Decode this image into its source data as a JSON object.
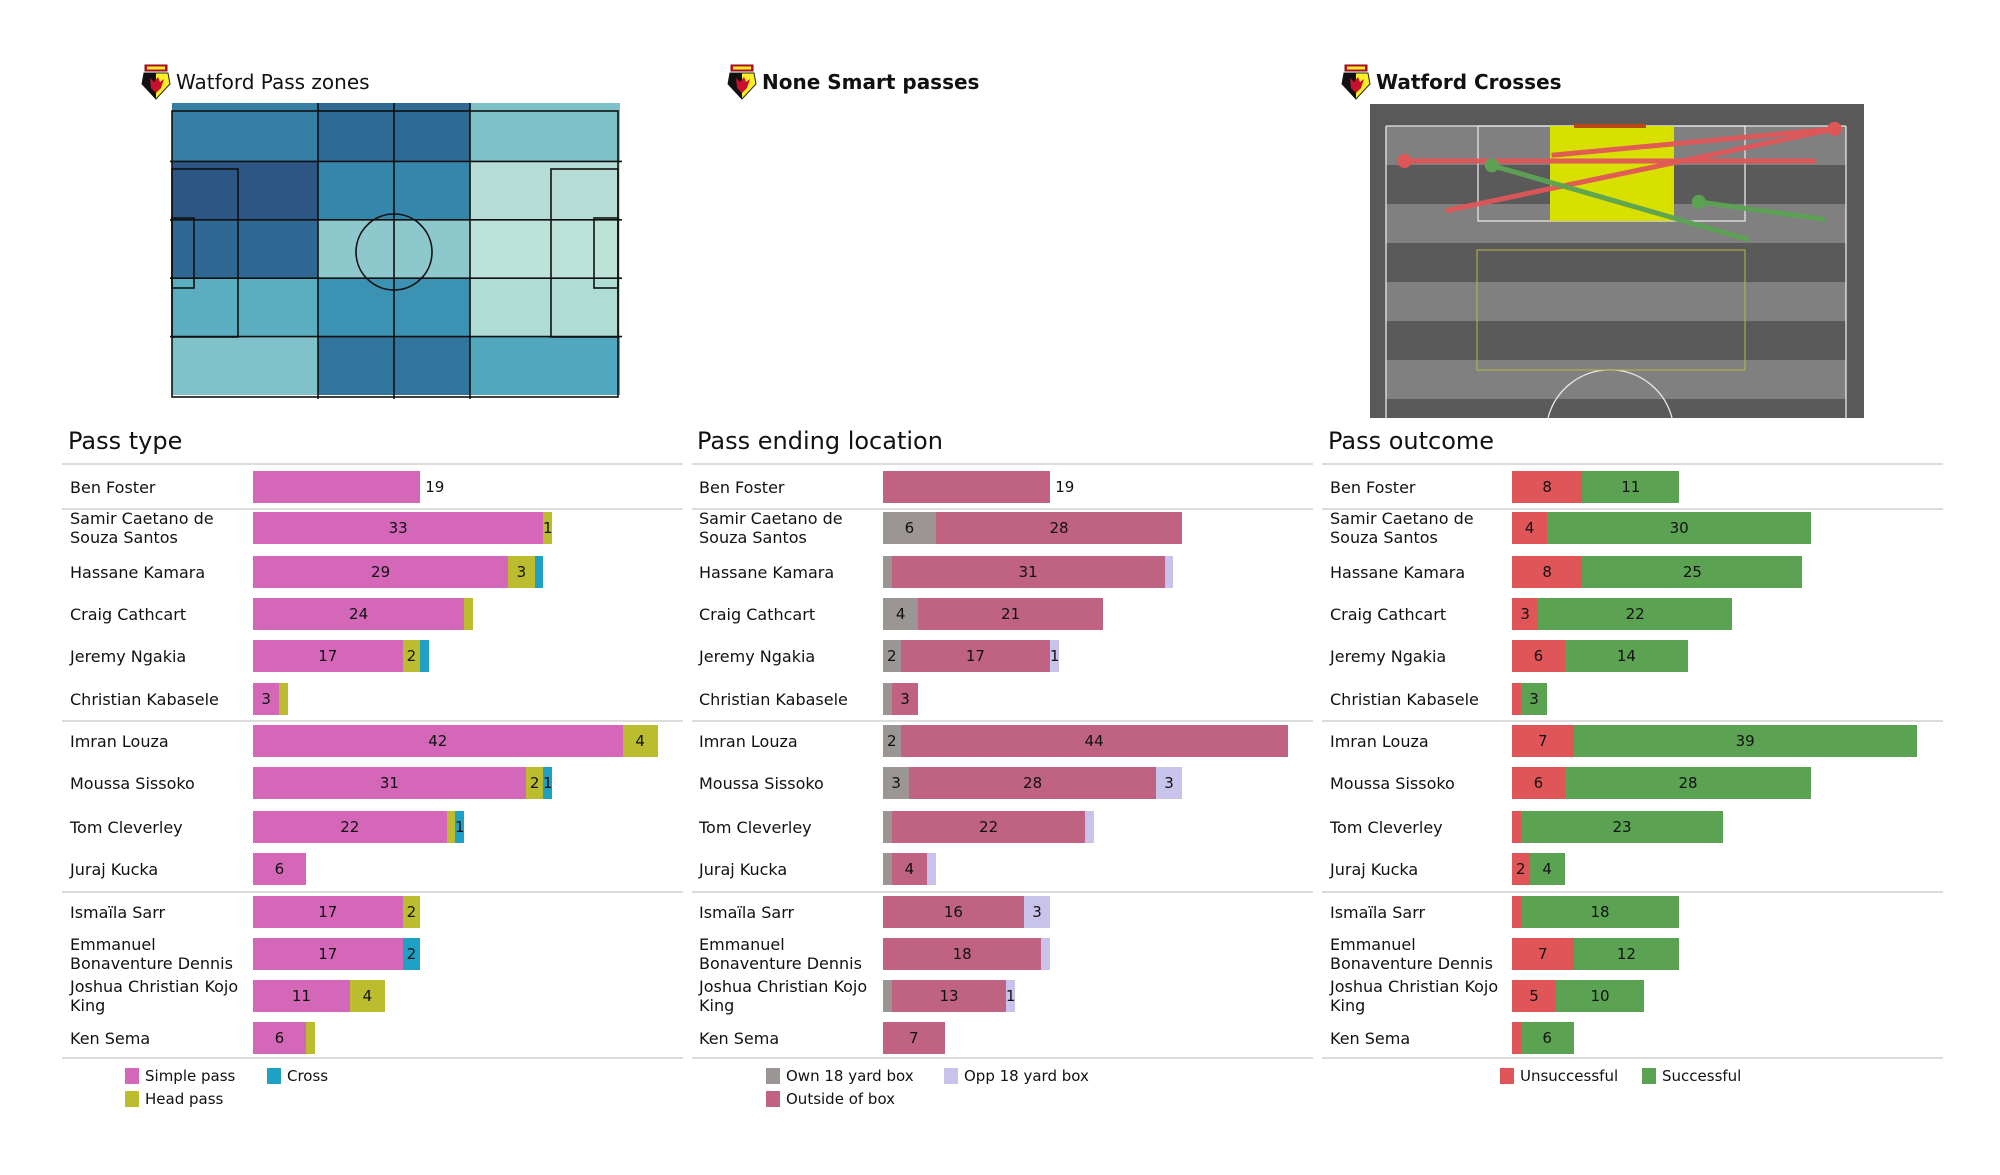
{
  "colors": {
    "simple_pass": "#d467b8",
    "head_pass": "#bcbd2e",
    "cross": "#1fa1c6",
    "own_box": "#9b9594",
    "outside_box": "#c06282",
    "opp_box": "#c8c3ea",
    "unsuccessful": "#e05658",
    "successful": "#5ba353"
  },
  "panels": {
    "pass_zones": {
      "title": "Watford Pass zones",
      "logo_icon": "watford-crest-icon"
    },
    "smart_passes": {
      "title": "None Smart passes",
      "logo_icon": "watford-crest-icon"
    },
    "crosses": {
      "title": "Watford Crosses",
      "logo_icon": "watford-crest-icon"
    }
  },
  "pass_zones": {
    "grid_cols": 3,
    "grid_rows": 5,
    "zone_colors": [
      [
        "#347fa3",
        "#2f6a94",
        "#7fc1c9"
      ],
      [
        "#2c5785",
        "#3586ab",
        "#b5ddd5"
      ],
      [
        "#306894",
        "#8cc8cc",
        "#bde3d8"
      ],
      [
        "#5aaec0",
        "#3b92b2",
        "#b0dcd6"
      ],
      [
        "#80c1ca",
        "#31749c",
        "#51a7bd"
      ]
    ]
  },
  "crosses": {
    "items": [
      {
        "outcome": "unsuccessful",
        "start": [
          0.975,
          0.01
        ],
        "end": [
          0.13,
          0.29
        ]
      },
      {
        "outcome": "unsuccessful",
        "start": [
          0.975,
          0.01
        ],
        "end": [
          0.36,
          0.1
        ]
      },
      {
        "outcome": "unsuccessful",
        "start": [
          0.04,
          0.12
        ],
        "end": [
          0.935,
          0.12
        ]
      },
      {
        "outcome": "successful",
        "start": [
          0.23,
          0.135
        ],
        "end": [
          0.79,
          0.39
        ]
      },
      {
        "outcome": "successful",
        "start": [
          0.68,
          0.26
        ],
        "end": [
          0.955,
          0.32
        ]
      }
    ]
  },
  "chart_data": [
    {
      "type": "bar",
      "orientation": "horizontal-stacked",
      "title": "Pass type",
      "categories": [
        "Ben Foster",
        "Samir Caetano de Souza Santos",
        "Hassane Kamara",
        "Craig Cathcart",
        "Jeremy Ngakia",
        "Christian Kabasele",
        "Imran Louza",
        "Moussa Sissoko",
        "Tom Cleverley",
        "Juraj Kucka",
        "Ismaïla Sarr",
        "Emmanuel Bonaventure Dennis",
        "Joshua Christian Kojo King",
        "Ken Sema"
      ],
      "category_lines": [
        [
          "Ben Foster"
        ],
        [
          "Samir Caetano de",
          "Souza Santos"
        ],
        [
          "Hassane Kamara"
        ],
        [
          "Craig Cathcart"
        ],
        [
          "Jeremy Ngakia"
        ],
        [
          "Christian Kabasele"
        ],
        [
          "Imran Louza"
        ],
        [
          "Moussa Sissoko"
        ],
        [
          "Tom Cleverley"
        ],
        [
          "Juraj Kucka"
        ],
        [
          "Ismaïla Sarr"
        ],
        [
          "Emmanuel",
          "Bonaventure Dennis"
        ],
        [
          "Joshua Christian Kojo",
          "King"
        ],
        [
          "Ken Sema"
        ]
      ],
      "group_breaks_after": [
        0,
        5,
        9
      ],
      "series": [
        {
          "name": "Simple pass",
          "color_key": "simple_pass",
          "values": [
            19,
            33,
            29,
            24,
            17,
            3,
            42,
            31,
            22,
            6,
            17,
            17,
            11,
            6
          ]
        },
        {
          "name": "Head pass",
          "color_key": "head_pass",
          "values": [
            0,
            1,
            3,
            1,
            2,
            1,
            4,
            2,
            1,
            0,
            2,
            0,
            4,
            1
          ]
        },
        {
          "name": "Cross",
          "color_key": "cross",
          "values": [
            0,
            0,
            1,
            0,
            1,
            0,
            0,
            1,
            1,
            0,
            0,
            2,
            0,
            0
          ]
        }
      ],
      "single_value_label_outside": true,
      "legend": {
        "placement": "bottom-left",
        "entries": [
          "Simple pass",
          "Cross",
          "Head pass"
        ]
      }
    },
    {
      "type": "bar",
      "orientation": "horizontal-stacked",
      "title": "Pass ending location",
      "categories": [
        "Ben Foster",
        "Samir Caetano de Souza Santos",
        "Hassane Kamara",
        "Craig Cathcart",
        "Jeremy Ngakia",
        "Christian Kabasele",
        "Imran Louza",
        "Moussa Sissoko",
        "Tom Cleverley",
        "Juraj Kucka",
        "Ismaïla Sarr",
        "Emmanuel Bonaventure Dennis",
        "Joshua Christian Kojo King",
        "Ken Sema"
      ],
      "category_lines": [
        [
          "Ben Foster"
        ],
        [
          "Samir Caetano de",
          "Souza Santos"
        ],
        [
          "Hassane Kamara"
        ],
        [
          "Craig Cathcart"
        ],
        [
          "Jeremy Ngakia"
        ],
        [
          "Christian Kabasele"
        ],
        [
          "Imran Louza"
        ],
        [
          "Moussa Sissoko"
        ],
        [
          "Tom Cleverley"
        ],
        [
          "Juraj Kucka"
        ],
        [
          "Ismaïla Sarr"
        ],
        [
          "Emmanuel",
          "Bonaventure Dennis"
        ],
        [
          "Joshua Christian Kojo",
          "King"
        ],
        [
          "Ken Sema"
        ]
      ],
      "group_breaks_after": [
        0,
        5,
        9
      ],
      "series": [
        {
          "name": "Own 18 yard box",
          "color_key": "own_box",
          "values": [
            0,
            6,
            1,
            4,
            2,
            1,
            2,
            3,
            1,
            1,
            0,
            0,
            1,
            0
          ]
        },
        {
          "name": "Outside of box",
          "color_key": "outside_box",
          "values": [
            19,
            28,
            31,
            21,
            17,
            3,
            44,
            28,
            22,
            4,
            16,
            18,
            13,
            7
          ]
        },
        {
          "name": "Opp 18 yard box",
          "color_key": "opp_box",
          "values": [
            0,
            0,
            1,
            0,
            1,
            0,
            0,
            3,
            1,
            1,
            3,
            1,
            1,
            0
          ]
        }
      ],
      "single_value_label_outside": true,
      "legend": {
        "placement": "bottom-left",
        "entries": [
          "Own 18 yard box",
          "Opp 18 yard box",
          "Outside of box"
        ]
      }
    },
    {
      "type": "bar",
      "orientation": "horizontal-stacked",
      "title": "Pass outcome",
      "categories": [
        "Ben Foster",
        "Samir Caetano de Souza Santos",
        "Hassane Kamara",
        "Craig Cathcart",
        "Jeremy Ngakia",
        "Christian Kabasele",
        "Imran Louza",
        "Moussa Sissoko",
        "Tom Cleverley",
        "Juraj Kucka",
        "Ismaïla Sarr",
        "Emmanuel Bonaventure Dennis",
        "Joshua Christian Kojo King",
        "Ken Sema"
      ],
      "category_lines": [
        [
          "Ben Foster"
        ],
        [
          "Samir Caetano de",
          "Souza Santos"
        ],
        [
          "Hassane Kamara"
        ],
        [
          "Craig Cathcart"
        ],
        [
          "Jeremy Ngakia"
        ],
        [
          "Christian Kabasele"
        ],
        [
          "Imran Louza"
        ],
        [
          "Moussa Sissoko"
        ],
        [
          "Tom Cleverley"
        ],
        [
          "Juraj Kucka"
        ],
        [
          "Ismaïla Sarr"
        ],
        [
          "Emmanuel",
          "Bonaventure Dennis"
        ],
        [
          "Joshua Christian Kojo",
          "King"
        ],
        [
          "Ken Sema"
        ]
      ],
      "group_breaks_after": [
        0,
        5,
        9
      ],
      "series": [
        {
          "name": "Unsuccessful",
          "color_key": "unsuccessful",
          "values": [
            8,
            4,
            8,
            3,
            6,
            1,
            7,
            6,
            1,
            2,
            1,
            7,
            5,
            1
          ]
        },
        {
          "name": "Successful",
          "color_key": "successful",
          "values": [
            11,
            30,
            25,
            22,
            14,
            3,
            39,
            28,
            23,
            4,
            18,
            12,
            10,
            6
          ]
        }
      ],
      "single_value_label_outside": false,
      "legend": {
        "placement": "bottom-center",
        "entries": [
          "Unsuccessful",
          "Successful"
        ]
      }
    }
  ]
}
